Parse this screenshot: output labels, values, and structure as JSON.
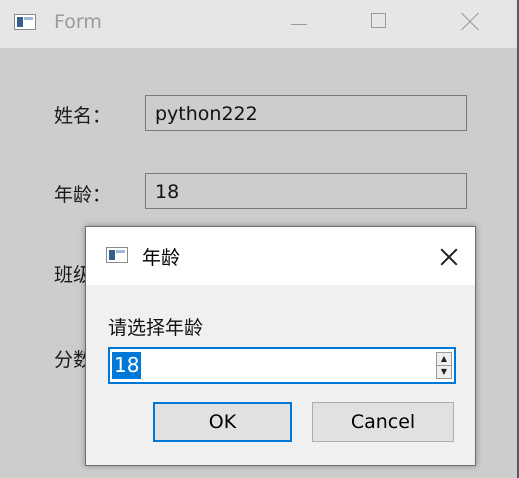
{
  "main_window": {
    "title": "Form",
    "fields": [
      {
        "label": "姓名：",
        "value": "python222"
      },
      {
        "label": "年龄：",
        "value": "18"
      },
      {
        "label": "班级"
      },
      {
        "label": "分数"
      }
    ]
  },
  "dialog": {
    "title": "年龄",
    "prompt": "请选择年龄",
    "spin_value": "18",
    "ok_label": "OK",
    "cancel_label": "Cancel"
  },
  "icons": {
    "app": "window-app-icon",
    "minimize": "minimize-icon",
    "maximize": "maximize-icon",
    "close": "close-icon",
    "spin_up": "triangle-up-icon",
    "spin_down": "triangle-down-icon"
  },
  "colors": {
    "accent": "#0078d7",
    "selection": "#0078d7",
    "window_bg": "#cdcdcd",
    "dialog_bg": "#f0f0f0"
  }
}
